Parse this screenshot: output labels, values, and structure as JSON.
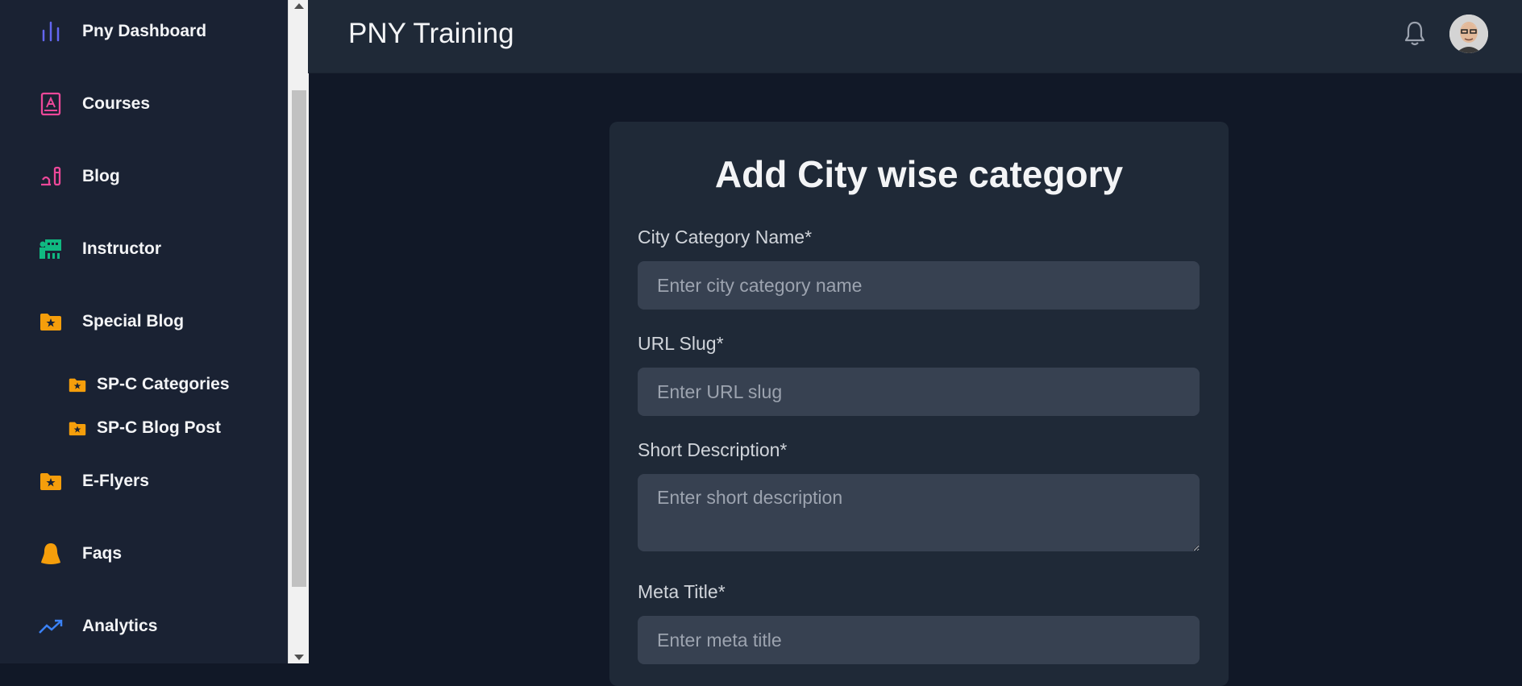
{
  "sidebar": {
    "items": [
      {
        "label": "Pny Dashboard",
        "icon": "bar-chart-icon",
        "color": "#6366f1"
      },
      {
        "label": "Courses",
        "icon": "book-icon",
        "color": "#ec4899"
      },
      {
        "label": "Blog",
        "icon": "pen-icon",
        "color": "#ec4899"
      },
      {
        "label": "Instructor",
        "icon": "chalkboard-teacher-icon",
        "color": "#10b981"
      },
      {
        "label": "Special Blog",
        "icon": "folder-star-icon",
        "color": "#f59e0b"
      }
    ],
    "subitems": [
      {
        "label": "SP-C Categories",
        "icon": "folder-star-icon",
        "color": "#f59e0b"
      },
      {
        "label": "SP-C Blog Post",
        "icon": "folder-star-icon",
        "color": "#f59e0b"
      }
    ],
    "items_after": [
      {
        "label": "E-Flyers",
        "icon": "folder-star-icon",
        "color": "#f59e0b"
      },
      {
        "label": "Faqs",
        "icon": "user-icon",
        "color": "#f59e0b"
      },
      {
        "label": "Analytics",
        "icon": "trending-up-icon",
        "color": "#3b82f6"
      }
    ]
  },
  "header": {
    "title": "PNY Training",
    "notification_icon": "bell-icon",
    "avatar_icon": "user-avatar"
  },
  "form": {
    "title": "Add City wise category",
    "fields": [
      {
        "label": "City Category Name*",
        "placeholder": "Enter city category name",
        "value": ""
      },
      {
        "label": "URL Slug*",
        "placeholder": "Enter URL slug",
        "value": ""
      },
      {
        "label": "Short Description*",
        "placeholder": "Enter short description",
        "value": ""
      },
      {
        "label": "Meta Title*",
        "placeholder": "Enter meta title",
        "value": ""
      }
    ]
  },
  "colors": {
    "sidebar_bg": "#1a2233",
    "main_bg": "#111827",
    "card_bg": "#1f2937",
    "input_bg": "#374151"
  }
}
